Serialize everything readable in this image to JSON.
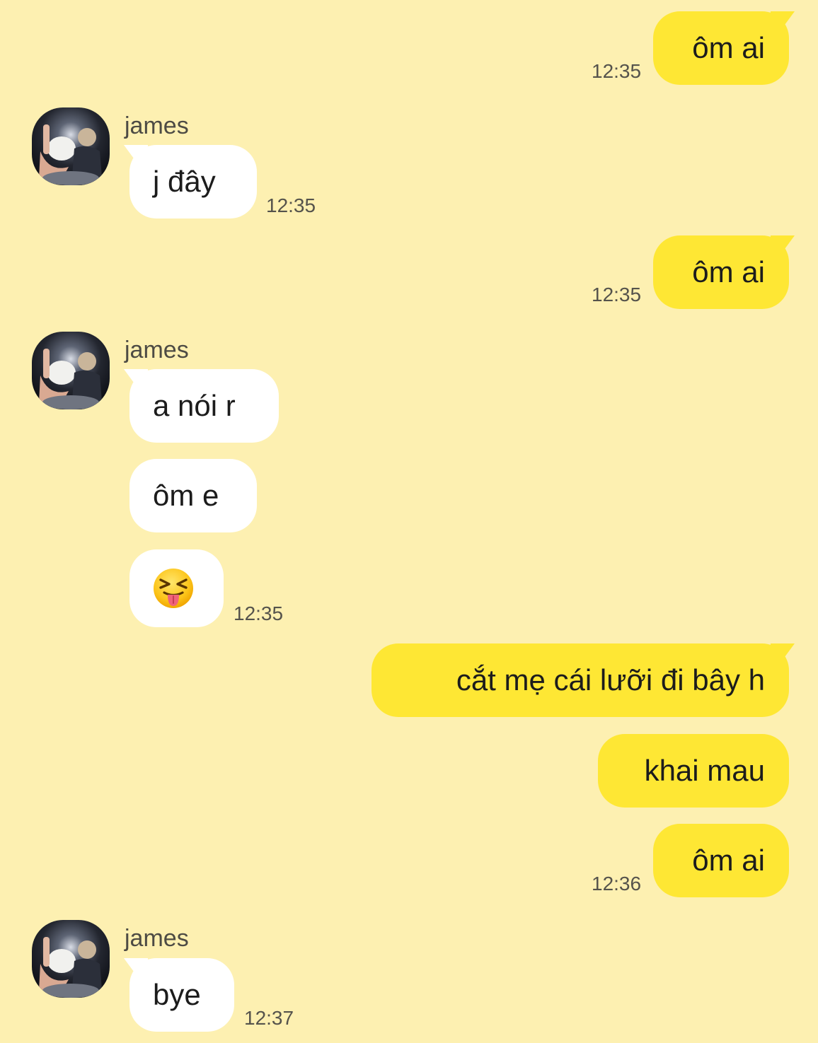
{
  "chat": {
    "contact_name": "james",
    "messages": [
      {
        "side": "out",
        "text": "ôm ai",
        "time": "12:35"
      },
      {
        "side": "in",
        "text": "j đây",
        "time": "12:35"
      },
      {
        "side": "out",
        "text": "ôm ai",
        "time": "12:35"
      },
      {
        "side": "in",
        "text": "a nói r",
        "time": ""
      },
      {
        "side": "in",
        "text": "ôm e",
        "time": ""
      },
      {
        "side": "in",
        "emoji": "squinting-face-with-tongue",
        "time": "12:35"
      },
      {
        "side": "out",
        "text": "cắt mẹ cái lưỡi đi bây h",
        "time": ""
      },
      {
        "side": "out",
        "text": "khai mau",
        "time": ""
      },
      {
        "side": "out",
        "text": "ôm ai",
        "time": "12:36"
      },
      {
        "side": "in",
        "text": "bye",
        "time": "12:37"
      }
    ]
  },
  "colors": {
    "background": "#fdf0b1",
    "outgoing_bubble": "#fee734",
    "incoming_bubble": "#ffffff",
    "message_text": "#1c1c1c",
    "timestamp_text": "#55534c"
  }
}
